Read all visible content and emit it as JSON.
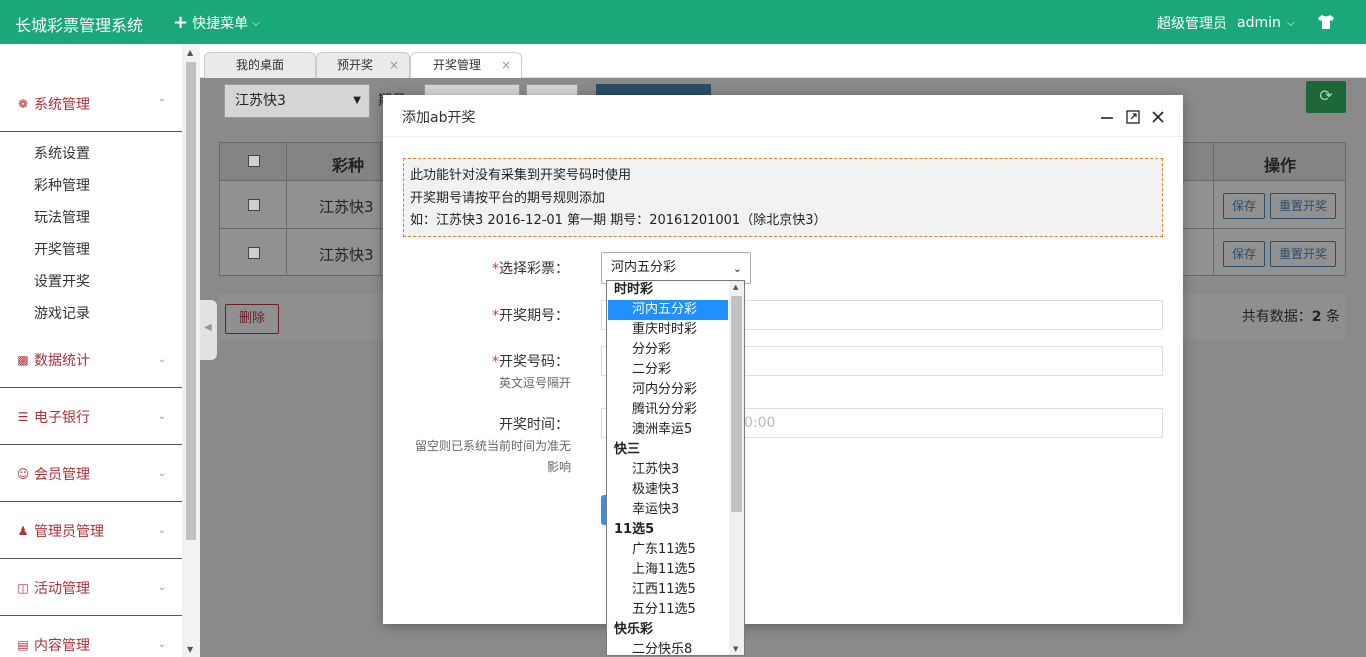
{
  "header": {
    "app_title": "长城彩票管理系统",
    "quick_menu_label": "快捷菜单",
    "role": "超级管理员",
    "username": "admin",
    "accent_color": "#1aa87a"
  },
  "sidebar": {
    "groups": [
      {
        "label": "系统管理",
        "icon": "gear-icon",
        "items": [
          "系统设置",
          "彩种管理",
          "玩法管理",
          "开奖管理",
          "设置开奖",
          "游戏记录"
        ]
      },
      {
        "label": "数据统计",
        "icon": "bar-chart-icon"
      },
      {
        "label": "电子银行",
        "icon": "list-icon"
      },
      {
        "label": "会员管理",
        "icon": "user-icon"
      },
      {
        "label": "管理员管理",
        "icon": "admin-icon"
      },
      {
        "label": "活动管理",
        "icon": "gift-icon"
      },
      {
        "label": "内容管理",
        "icon": "document-icon"
      }
    ]
  },
  "tabs": [
    {
      "label": "我的桌面"
    },
    {
      "label": "预开奖"
    },
    {
      "label": "开奖管理"
    }
  ],
  "toolbar": {
    "lottery_select": "江苏快3",
    "issue_label": "期号"
  },
  "table": {
    "headers": {
      "lottery": "彩种",
      "actions": "操作"
    },
    "rows": [
      {
        "lottery": "江苏快3",
        "save": "保存",
        "reset": "重置开奖"
      },
      {
        "lottery": "江苏快3",
        "save": "保存",
        "reset": "重置开奖"
      }
    ],
    "delete_label": "删除",
    "total_prefix": "共有数据：",
    "total_count": "2",
    "total_suffix": " 条"
  },
  "modal": {
    "title": "添加ab开奖",
    "notice": [
      "此功能针对没有采集到开奖号码时使用",
      "开奖期号请按平台的期号规则添加",
      "如：江苏快3 2016-12-01 第一期 期号：20161201001（除北京快3）"
    ],
    "fields": {
      "lottery": {
        "label": "选择彩票：",
        "value": "河内五分彩"
      },
      "issue": {
        "label": "开奖期号："
      },
      "numbers": {
        "label": "开奖号码：",
        "hint": "英文逗号隔开"
      },
      "time": {
        "label": "开奖时间：",
        "hint_line1": "留空则已系统当前时间为准无",
        "hint_line2": "影响",
        "placeholder_tail": "0:00"
      }
    }
  },
  "dropdown": {
    "entries": [
      {
        "text": "时时彩",
        "type": "group"
      },
      {
        "text": "河内五分彩",
        "type": "option",
        "selected": true
      },
      {
        "text": "重庆时时彩",
        "type": "option"
      },
      {
        "text": "分分彩",
        "type": "option"
      },
      {
        "text": "二分彩",
        "type": "option"
      },
      {
        "text": "河内分分彩",
        "type": "option"
      },
      {
        "text": "腾讯分分彩",
        "type": "option"
      },
      {
        "text": "澳洲幸运5",
        "type": "option"
      },
      {
        "text": "快三",
        "type": "group"
      },
      {
        "text": "江苏快3",
        "type": "option"
      },
      {
        "text": "极速快3",
        "type": "option"
      },
      {
        "text": "幸运快3",
        "type": "option"
      },
      {
        "text": "11选5",
        "type": "group"
      },
      {
        "text": "广东11选5",
        "type": "option"
      },
      {
        "text": "上海11选5",
        "type": "option"
      },
      {
        "text": "江西11选5",
        "type": "option"
      },
      {
        "text": "五分11选5",
        "type": "option"
      },
      {
        "text": "快乐彩",
        "type": "group"
      },
      {
        "text": "二分快乐8",
        "type": "option"
      }
    ]
  }
}
